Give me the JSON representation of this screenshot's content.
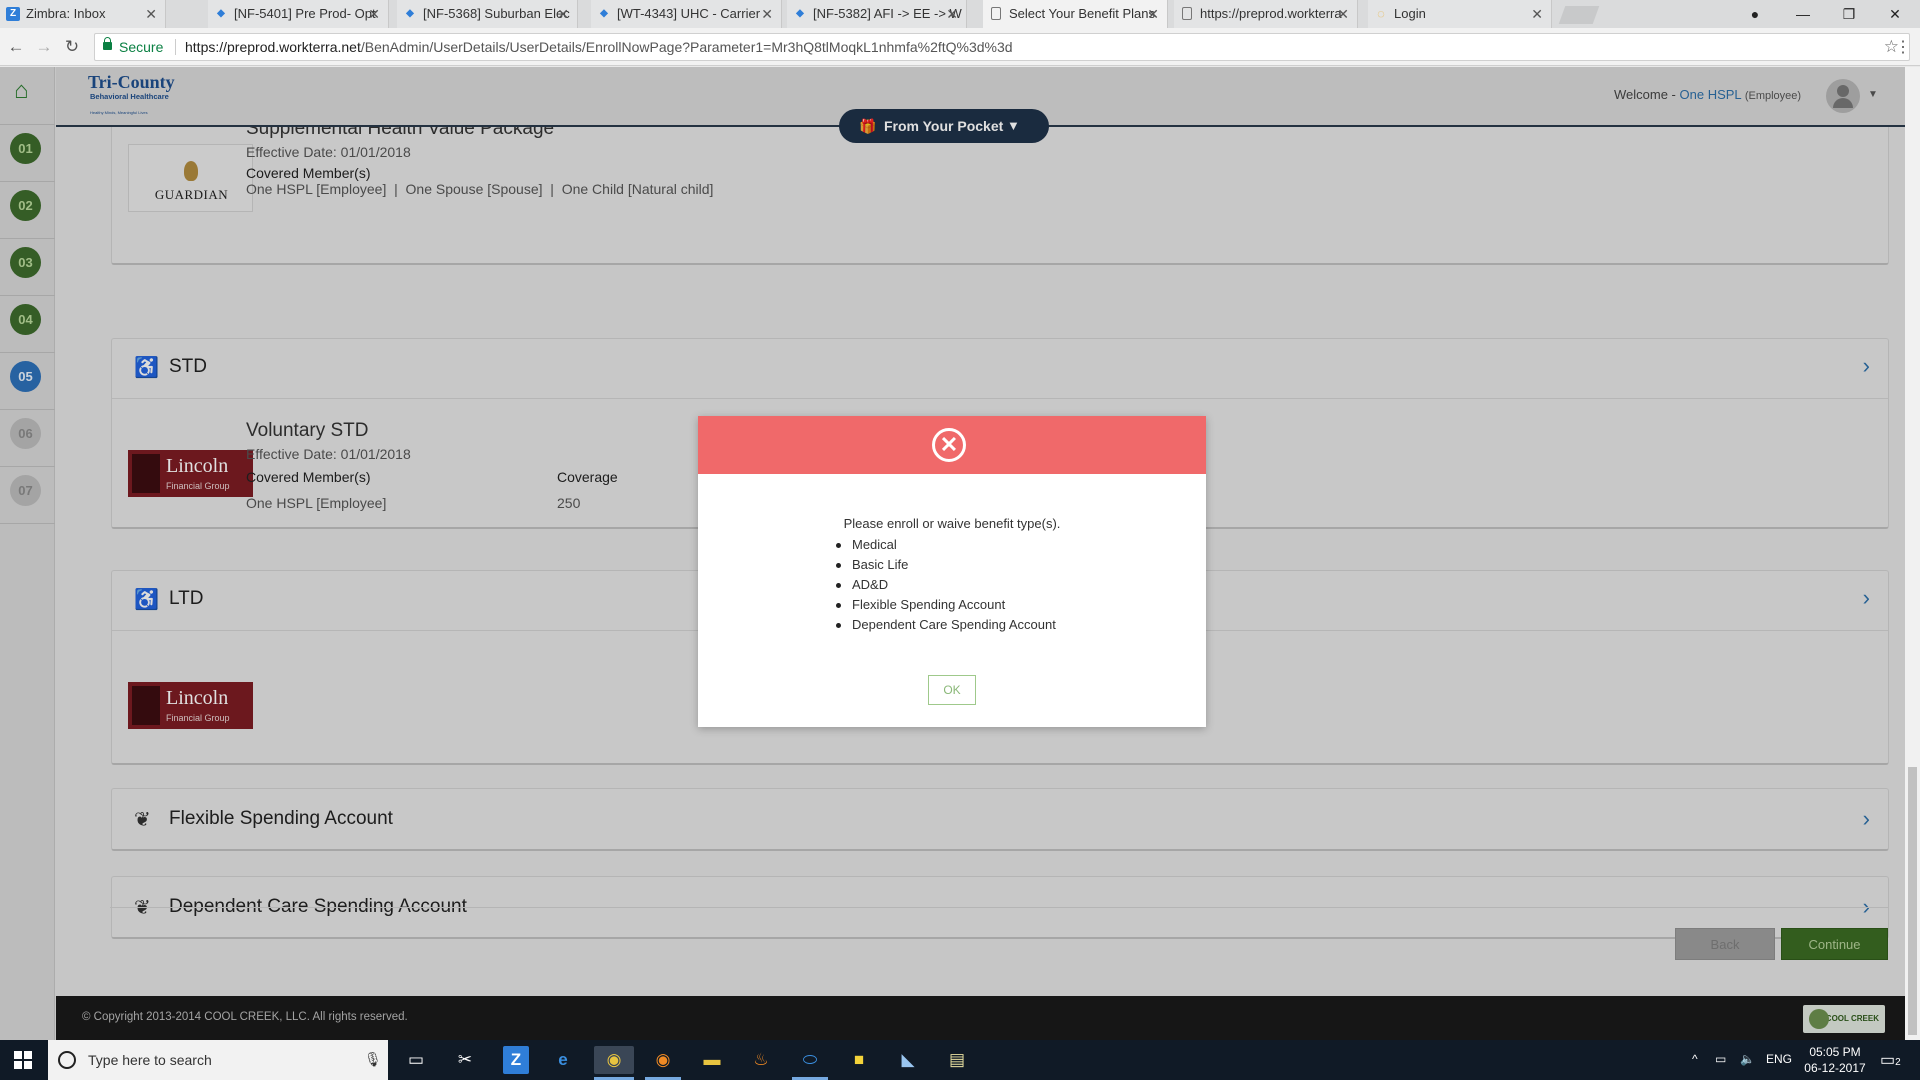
{
  "browser": {
    "tabs": [
      {
        "title": "Zimbra: Inbox",
        "icon": "zimbra-icon",
        "color": "#2f7ed8",
        "glyph": "Z"
      },
      {
        "title": "[NF-5401] Pre Prod- Opt",
        "icon": "jira-icon",
        "color": "#2f7ed8",
        "glyph": "◆"
      },
      {
        "title": "[NF-5368] Suburban Elec",
        "icon": "jira-icon",
        "color": "#2f7ed8",
        "glyph": "◆"
      },
      {
        "title": "[WT-4343] UHC - Carrier",
        "icon": "jira-icon",
        "color": "#2f7ed8",
        "glyph": "◆"
      },
      {
        "title": "[NF-5382] AFI -> EE -> W",
        "icon": "jira-icon",
        "color": "#2f7ed8",
        "glyph": "◆"
      },
      {
        "title": "Select Your Benefit Plans",
        "icon": "page-icon",
        "color": "#ffffff",
        "glyph": ""
      },
      {
        "title": "https://preprod.workterra",
        "icon": "page-icon",
        "color": "#ffffff",
        "glyph": ""
      },
      {
        "title": "Login",
        "icon": "loading-icon",
        "color": "#e8b64a",
        "glyph": "◌"
      }
    ],
    "secure_label": "Secure",
    "url_host": "https://preprod.workterra.net",
    "url_path": "/BenAdmin/UserDetails/UserDetails/EnrollNowPage?Parameter1=Mr3hQ8tlMoqkL1nhmfa%2ftQ%3d%3d"
  },
  "app": {
    "logo_line1": "Tri-County",
    "logo_line2": "Behavioral Healthcare",
    "logo_tagline": "Healthy Minds, Meaningful Lives",
    "welcome_prefix": "Welcome -",
    "user_name": "One HSPL",
    "user_role": "(Employee)",
    "pocket_label": "From Your Pocket",
    "steps": [
      {
        "num": "01",
        "state": "done"
      },
      {
        "num": "02",
        "state": "done"
      },
      {
        "num": "03",
        "state": "done"
      },
      {
        "num": "04",
        "state": "done"
      },
      {
        "num": "05",
        "state": "current"
      },
      {
        "num": "06",
        "state": "todo"
      },
      {
        "num": "07",
        "state": "todo"
      }
    ]
  },
  "sections": {
    "supplemental": {
      "plan_name": "Supplemental Health Value Package",
      "effective": "Effective Date: 01/01/2018",
      "covered_label": "Covered Member(s)",
      "members": "One HSPL [Employee]  |  One Spouse [Spouse]  |  One Child [Natural child]",
      "carrier": "GUARDIAN"
    },
    "std": {
      "title": "STD",
      "plan_name": "Voluntary STD",
      "effective": "Effective Date: 01/01/2018",
      "covered_label": "Covered Member(s)",
      "coverage_label": "Coverage",
      "member": "One HSPL [Employee]",
      "coverage": "250",
      "carrier_name": "Lincoln",
      "carrier_sub": "Financial Group"
    },
    "ltd": {
      "title": "LTD",
      "carrier_name": "Lincoln",
      "carrier_sub": "Financial Group"
    },
    "fsa": {
      "title": "Flexible Spending Account"
    },
    "dcsa": {
      "title": "Dependent Care Spending Account"
    }
  },
  "buttons": {
    "back": "Back",
    "continue": "Continue"
  },
  "footer": {
    "copyright": "© Copyright 2013-2014 COOL CREEK, LLC. All rights reserved.",
    "brand": "COOL CREEK"
  },
  "modal": {
    "message": "Please enroll or waive benefit type(s).",
    "items": [
      "Medical",
      "Basic Life",
      "AD&D",
      "Flexible Spending Account",
      "Dependent Care Spending Account"
    ],
    "ok_label": "OK",
    "header_color": "#f0696a"
  },
  "taskbar": {
    "search_placeholder": "Type here to search",
    "language": "ENG",
    "time": "05:05 PM",
    "date": "06-12-2017",
    "notifications": "2"
  }
}
